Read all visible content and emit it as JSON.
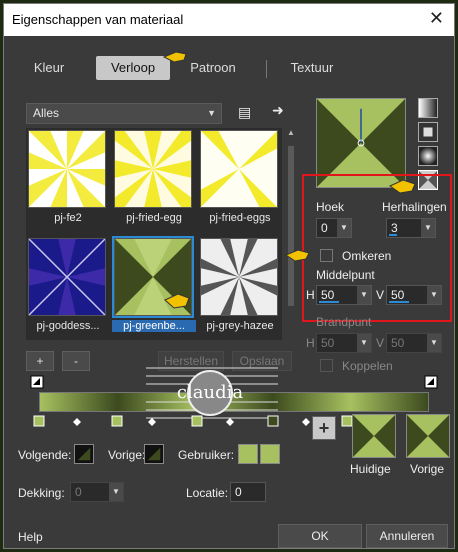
{
  "window": {
    "title": "Eigenschappen van materiaal",
    "close_label": "✕"
  },
  "tabs": [
    {
      "label": "Kleur"
    },
    {
      "label": "Verloop"
    },
    {
      "label": "Patroon"
    },
    {
      "label": "Textuur"
    }
  ],
  "library": {
    "category_selected": "Alles",
    "items": [
      {
        "label": "pj-fe2"
      },
      {
        "label": "pj-fried-egg"
      },
      {
        "label": "pj-fried-eggs"
      },
      {
        "label": "pj-goddess..."
      },
      {
        "label": "pj-greenbe..."
      },
      {
        "label": "pj-grey-hazee"
      }
    ],
    "add_label": "+",
    "remove_label": "-",
    "restore_label": "Herstellen",
    "save_label": "Opslaan"
  },
  "settings": {
    "angle_label": "Hoek",
    "angle_value": "0",
    "repeats_label": "Herhalingen",
    "repeats_value": "3",
    "invert_label": "Omkeren",
    "center_label": "Middelpunt",
    "center_h_label": "H",
    "center_h_value": "50",
    "center_v_label": "V",
    "center_v_value": "50",
    "focus_label": "Brandpunt",
    "focus_h_label": "H",
    "focus_h_value": "50",
    "focus_v_label": "V",
    "focus_v_value": "50",
    "link_label": "Koppelen"
  },
  "editor": {
    "next_label": "Volgende:",
    "prev_label": "Vorige:",
    "user_label": "Gebruiker:",
    "opacity_label": "Dekking:",
    "opacity_value": "0",
    "location_label": "Locatie:",
    "location_value": "0",
    "plus_label": "+",
    "current_label": "Huidige",
    "previous_label": "Vorige"
  },
  "footer": {
    "help_label": "Help",
    "ok_label": "OK",
    "cancel_label": "Annuleren"
  },
  "watermark_text": "claudia",
  "colors": {
    "green_light": "#a7c160",
    "green_dark": "#3c4a1e",
    "yellow": "#f2ea2a",
    "blue_deep": "#1a1a8a",
    "accent_blue": "#2a8ad4",
    "highlight_red": "#e0161b"
  }
}
